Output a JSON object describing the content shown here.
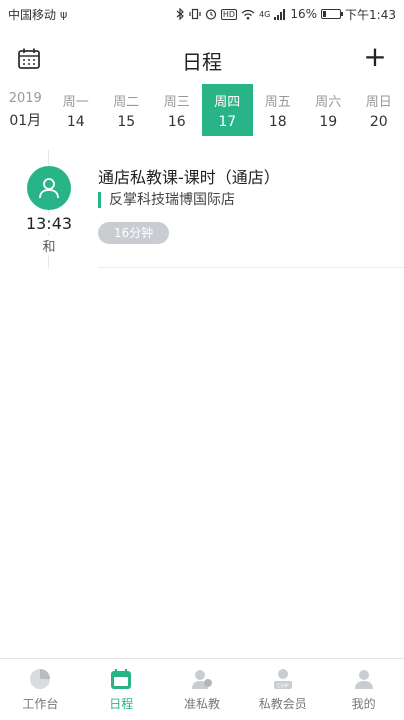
{
  "status_bar": {
    "carrier": "中国移动",
    "usb_symbol": "ψ",
    "hd": "HD",
    "network": "4G",
    "battery_percent": "16%",
    "battery_level": 0.16,
    "time": "下午1:43"
  },
  "header": {
    "title": "日程",
    "add_label": "+"
  },
  "week": {
    "year_label": "2019",
    "month_label": "01月",
    "days": [
      {
        "weekday": "周一",
        "date": "14"
      },
      {
        "weekday": "周二",
        "date": "15"
      },
      {
        "weekday": "周三",
        "date": "16"
      },
      {
        "weekday": "周四",
        "date": "17"
      },
      {
        "weekday": "周五",
        "date": "18"
      },
      {
        "weekday": "周六",
        "date": "19"
      },
      {
        "weekday": "周日",
        "date": "20"
      }
    ],
    "accent_color": "#28b487"
  },
  "event": {
    "time": "13:43",
    "person": "和",
    "title": "通店私教课-课时（通店）",
    "store": "反掌科技瑞博国际店",
    "duration": "16分钟"
  },
  "tabbar": {
    "items": [
      {
        "label": "工作台",
        "icon": "workbench-icon"
      },
      {
        "label": "日程",
        "icon": "calendar-icon"
      },
      {
        "label": "准私教",
        "icon": "prospect-icon"
      },
      {
        "label": "私教会员",
        "icon": "member-icon"
      },
      {
        "label": "我的",
        "icon": "profile-icon"
      }
    ],
    "active_index": 1
  }
}
